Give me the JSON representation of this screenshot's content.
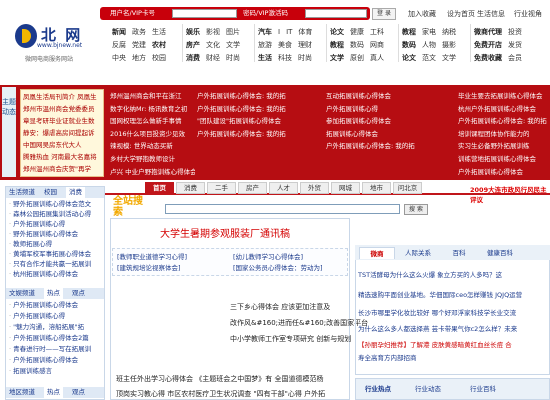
{
  "top": {
    "username_label": "用户名/VIP卡号",
    "password_label": "密码/VIP激活码",
    "login_btn": "登 录",
    "links": [
      "加入收藏",
      "设为首页",
      "生活信息",
      "行业视角"
    ]
  },
  "logo": {
    "name": "北 网",
    "url": "www.bjnew.net",
    "sub": "微网电商服务网站"
  },
  "nav": {
    "col1": [
      [
        "新闻",
        "政务",
        "生活"
      ],
      [
        "反腐",
        "党建",
        "农村"
      ],
      [
        "中央",
        "地方",
        "校园"
      ]
    ],
    "col2": [
      [
        "娱乐",
        "影视",
        "图片"
      ],
      [
        "房产",
        "文化",
        "文学"
      ],
      [
        "消费",
        "财经",
        "时尚"
      ]
    ],
    "col3": [
      [
        "汽车",
        "I",
        "IT",
        "体育"
      ],
      [
        "旅游",
        "美食",
        "理财"
      ],
      [
        "生活",
        "科技",
        "时尚"
      ]
    ],
    "col4": [
      [
        "论文",
        "健康",
        "工科"
      ],
      [
        "教程",
        "数码",
        "网商"
      ],
      [
        "文学",
        "原创",
        "真人"
      ]
    ],
    "col5": [
      [
        "教程",
        "家电",
        "纳税"
      ],
      [
        "数码",
        "人物",
        "摄影"
      ],
      [
        "论文",
        "范文",
        "文学"
      ]
    ],
    "col6": [
      [
        "微商代理"
      ],
      [
        "免费开店"
      ],
      [
        "免费收藏"
      ]
    ],
    "col7": [
      [
        "投资"
      ],
      [
        "发货"
      ],
      [
        "会员"
      ]
    ]
  },
  "banner": {
    "side_label": "主题动态",
    "ticker": [
      "凤凰生活局刊简介 凤凰生",
      "郑州市温州商会党委委员",
      "章显考研毕业证就业生数",
      "静安：爆虐高房间提起诉",
      "中国网吴房东代大人",
      "腾雅热血 河南最大名嘉将",
      "郑州温州商会庆贺\"再学"
    ],
    "col1": [
      "郑州温州商会和平在浙江",
      "数字化纳Mr: 杨讯数育之初",
      "国网权理怎么做新手事情",
      "2016什么项目投资少见效",
      "辣视模: 世界动态买新",
      "乡村大学野抱教师设计",
      "卢兴 中业户野抱训练心得体会"
    ],
    "col2": [
      "户外拓展训练心得体会: 我的拓",
      "户外拓展训练心得体会: 我的拓",
      "",
      "",
      "",
      "\"团队建设\"拓展训练心得体会",
      "户外拓展训练心得体会: 我的拓"
    ],
    "col3": [
      "互动拓展训练心得体会",
      "户外拓展训练心得",
      "",
      "",
      "参加拓展训练心得体会",
      "拓展训练心得体会",
      "户外拓展训练心得体会: 我的拓"
    ],
    "col4": [
      "毕业生要去拓展训练心得体会",
      "杭州户外拓展训练心得体会",
      "户外拓展训练心得体会: 我的拓",
      "培训课程团体协作能力的",
      "实习生必备野外拓展训练",
      "训练营地拓展训练心得体会",
      "户外拓展训练心得体会"
    ]
  },
  "tabs": [
    "首页",
    "消费",
    "二手",
    "房产",
    "人才",
    "外贸",
    "网城",
    "地市",
    "问北京"
  ],
  "tab_notice": "2009大连市政风行风民主评议",
  "left": {
    "head1": [
      "生活频道",
      "校园",
      "消费"
    ],
    "items1": [
      "野外拓展训练心得体会范文",
      "森林公园拓展集训活动心得",
      "户外拓展训练心得",
      "野外拓展训练心得体会",
      "教师拓展心得",
      "黄埔军校军事拓展心得体会",
      "只有合作才能共赢一拓展训",
      "杭州拓展训练心得体会"
    ],
    "head2": [
      "文娱频道",
      "热点",
      "观点"
    ],
    "items2": [
      "户外拓展训练心得体会",
      "户外拓展训练心得",
      "\"魅力沟通，溶船拓展\"拓",
      "户外拓展训练心得体会2篇",
      "青春进行时——写在拓展训",
      "户外拓展训练心得体会",
      "拓展训练感言"
    ],
    "head3": [
      "地区频道",
      "热点",
      "观点"
    ]
  },
  "search": {
    "logo": "全站搜索",
    "button": "搜 索"
  },
  "feature": {
    "title": "大学生暑期参观服装厂通讯稿",
    "box": [
      "[教师职业道德学习心得]",
      "[幼儿教师学习心得体会]",
      "[建筑规培论视察体会]",
      "[国家公务员心得体会：劳动为]"
    ],
    "lines": [
      "三下乡心得体会 应该更加注意及",
      "改作风&#160;进而任&#160;改善国家平台",
      "中小学教师工作室专项研究 创新与规划",
      "班主任外出学习心得体会 《主题班会之中国梦》有 全国道德模范杨",
      "顶岗实习教心得 市区农村医疗卫生状况调查 \"四有干部\"心得 户外拓"
    ]
  },
  "right": {
    "tabs": [
      "微商",
      "人际关系",
      "百科",
      "健康百科"
    ],
    "lines": [
      "TST活酵母为什么这么火爆 象立方买的人多吗？这",
      "精选速购平面创业基地。华佃国际ceo怎样赚钱 JQJQ运营",
      "长沙市哪里学化妆比较好 哪个好邓浮家科技学长业交流",
      "为什么这么多人都选择燕 芸卡带果气你c2怎么样？未来",
      "【孙丽孕妇推荐】了解港 皮肤黄感暗黄红血丝长痘 合",
      "寿全高育方内部招商"
    ],
    "industry": [
      "行业热点",
      "行业动态",
      "行业百科"
    ]
  }
}
